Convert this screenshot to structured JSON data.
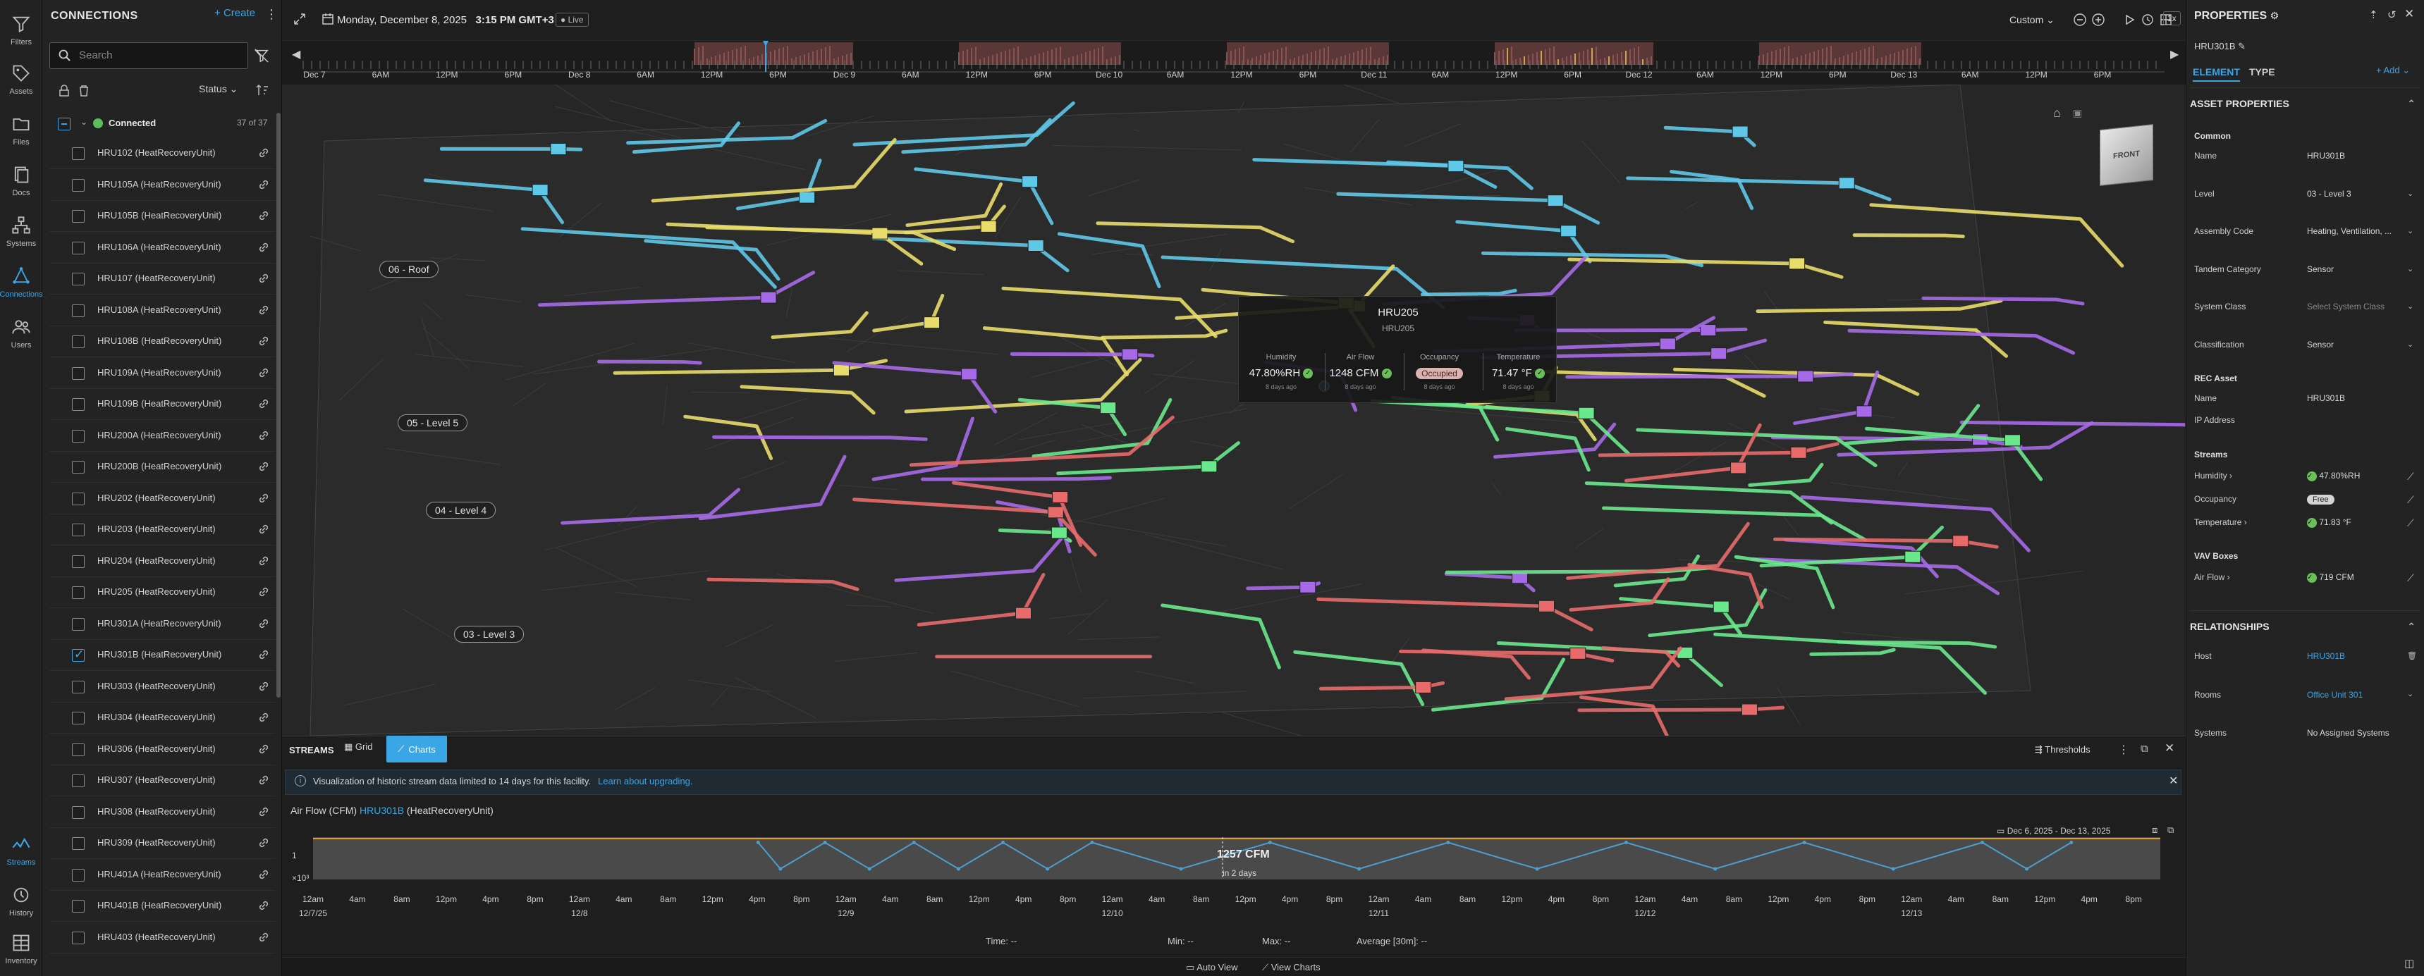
{
  "rail": {
    "items": [
      {
        "label": "Filters",
        "icon": "filter-icon"
      },
      {
        "label": "Assets",
        "icon": "tag-icon"
      },
      {
        "label": "Files",
        "icon": "folder-icon"
      },
      {
        "label": "Docs",
        "icon": "docs-icon"
      },
      {
        "label": "Systems",
        "icon": "systems-icon"
      },
      {
        "label": "Connections",
        "icon": "connections-icon"
      },
      {
        "label": "Users",
        "icon": "users-icon"
      },
      {
        "label": "Streams",
        "icon": "streams-icon"
      },
      {
        "label": "History",
        "icon": "history-icon"
      },
      {
        "label": "Inventory",
        "icon": "inventory-icon"
      }
    ],
    "font_label": "Ab"
  },
  "connections": {
    "title": "CONNECTIONS",
    "create_label": "Create",
    "search_placeholder": "Search",
    "status_label": "Status",
    "group_label": "Connected",
    "group_count": "37 of 37",
    "items": [
      {
        "label": "HRU102 (HeatRecoveryUnit)",
        "checked": false
      },
      {
        "label": "HRU105A (HeatRecoveryUnit)",
        "checked": false
      },
      {
        "label": "HRU105B (HeatRecoveryUnit)",
        "checked": false
      },
      {
        "label": "HRU106A (HeatRecoveryUnit)",
        "checked": false
      },
      {
        "label": "HRU107 (HeatRecoveryUnit)",
        "checked": false
      },
      {
        "label": "HRU108A (HeatRecoveryUnit)",
        "checked": false
      },
      {
        "label": "HRU108B (HeatRecoveryUnit)",
        "checked": false
      },
      {
        "label": "HRU109A (HeatRecoveryUnit)",
        "checked": false
      },
      {
        "label": "HRU109B (HeatRecoveryUnit)",
        "checked": false
      },
      {
        "label": "HRU200A (HeatRecoveryUnit)",
        "checked": false
      },
      {
        "label": "HRU200B (HeatRecoveryUnit)",
        "checked": false
      },
      {
        "label": "HRU202 (HeatRecoveryUnit)",
        "checked": false
      },
      {
        "label": "HRU203 (HeatRecoveryUnit)",
        "checked": false
      },
      {
        "label": "HRU204 (HeatRecoveryUnit)",
        "checked": false
      },
      {
        "label": "HRU205 (HeatRecoveryUnit)",
        "checked": false
      },
      {
        "label": "HRU301A (HeatRecoveryUnit)",
        "checked": false
      },
      {
        "label": "HRU301B (HeatRecoveryUnit)",
        "checked": true
      },
      {
        "label": "HRU303 (HeatRecoveryUnit)",
        "checked": false
      },
      {
        "label": "HRU304 (HeatRecoveryUnit)",
        "checked": false
      },
      {
        "label": "HRU306 (HeatRecoveryUnit)",
        "checked": false
      },
      {
        "label": "HRU307 (HeatRecoveryUnit)",
        "checked": false
      },
      {
        "label": "HRU308 (HeatRecoveryUnit)",
        "checked": false
      },
      {
        "label": "HRU309 (HeatRecoveryUnit)",
        "checked": false
      },
      {
        "label": "HRU401A (HeatRecoveryUnit)",
        "checked": false
      },
      {
        "label": "HRU401B (HeatRecoveryUnit)",
        "checked": false
      },
      {
        "label": "HRU403 (HeatRecoveryUnit)",
        "checked": false
      }
    ]
  },
  "topbar": {
    "date": "Monday, December 8, 2025",
    "time": "3:15 PM GMT+3",
    "live": "Live",
    "range_mode": "Custom",
    "speed": "1x",
    "timeline_labels": [
      "Dec 7",
      "6AM",
      "12PM",
      "6PM",
      "Dec 8",
      "6AM",
      "12PM",
      "6PM",
      "Dec 9",
      "6AM",
      "12PM",
      "6PM",
      "Dec 10",
      "6AM",
      "12PM",
      "6PM",
      "Dec 11",
      "6AM",
      "12PM",
      "6PM",
      "Dec 12",
      "6AM",
      "12PM",
      "6PM",
      "Dec 13",
      "6AM",
      "12PM",
      "6PM"
    ]
  },
  "viewport": {
    "levels": [
      "06 - Roof",
      "05 - Level 5",
      "04 - Level 4",
      "03 - Level 3"
    ],
    "cube_label": "FRONT",
    "tooltip": {
      "title": "HRU205",
      "subtitle": "HRU205",
      "metrics": [
        {
          "label": "Humidity",
          "value": "47.80%RH",
          "age": "8 days ago"
        },
        {
          "label": "Air Flow",
          "value": "1248 CFM",
          "age": "8 days ago"
        },
        {
          "label": "Occupancy",
          "value": "Occupied",
          "age": "8 days ago"
        },
        {
          "label": "Temperature",
          "value": "71.47 °F",
          "age": "8 days ago"
        }
      ]
    }
  },
  "streams": {
    "title": "STREAMS",
    "grid_tab": "Grid",
    "charts_tab": "Charts",
    "thresholds": "Thresholds",
    "banner_text": "Visualization of historic stream data limited to 14 days for this facility.",
    "banner_link": "Learn about upgrading.",
    "chart_title_prefix": "Air Flow (CFM)",
    "chart_title_asset": "HRU301B",
    "chart_title_suffix": "(HeatRecoveryUnit)",
    "date_range": "Dec 6, 2025 - Dec 13, 2025",
    "hover_value": "1257 CFM",
    "hover_sub": "in 2 days",
    "footer": {
      "time": "Time: --",
      "min": "Min: --",
      "max": "Max: --",
      "average": "Average [30m]: --"
    },
    "bottom": {
      "auto_view": "Auto View",
      "view_charts": "View Charts"
    }
  },
  "chart_data": {
    "type": "area",
    "title": "Air Flow (CFM)",
    "y_tick_labels": [
      "1",
      "×10³"
    ],
    "x_tick_labels": [
      "12am\n12/7/25",
      "4am",
      "8am",
      "12pm",
      "4pm",
      "8pm",
      "12am\n12/8",
      "4am",
      "8am",
      "12pm",
      "4pm",
      "8pm",
      "12am\n12/9",
      "4am",
      "8am",
      "12pm",
      "4pm",
      "8pm",
      "12am\n12/10",
      "4am",
      "8am",
      "12pm",
      "4pm",
      "8pm",
      "12am\n12/11",
      "4am",
      "8am",
      "12pm",
      "4pm",
      "8pm",
      "12am\n12/12",
      "4am",
      "8am",
      "12pm",
      "4pm",
      "8pm",
      "12am\n12/13",
      "4am",
      "8am",
      "12pm",
      "4pm",
      "8pm"
    ],
    "x_range": [
      "2025-12-07 00:00",
      "2025-12-13 22:00"
    ],
    "series": [
      {
        "color": "#4d9fd1",
        "x": [
          "12/8 16:00",
          "12/8 18:00",
          "12/8 22:00",
          "12/9 02:00",
          "12/9 06:00",
          "12/9 10:00",
          "12/9 14:00",
          "12/9 18:00",
          "12/9 22:00",
          "12/10 06:00",
          "12/10 14:00",
          "12/10 22:00",
          "12/11 06:00",
          "12/11 14:00",
          "12/11 22:00",
          "12/12 06:00",
          "12/12 14:00",
          "12/12 22:00",
          "12/13 06:00",
          "12/13 10:00",
          "12/13 14:00"
        ],
        "y": [
          1250,
          1000,
          1250,
          1000,
          1250,
          1000,
          1250,
          1000,
          1250,
          1000,
          1250,
          1000,
          1250,
          1000,
          1250,
          1000,
          1250,
          1000,
          1250,
          1000,
          1250
        ]
      }
    ],
    "threshold_color": "#e0a030",
    "grid": true
  },
  "properties": {
    "title": "PROPERTIES",
    "asset": "HRU301B",
    "tab_element": "ELEMENT",
    "tab_type": "TYPE",
    "add_label": "Add",
    "section_asset": "ASSET PROPERTIES",
    "common_label": "Common",
    "common": [
      {
        "key": "Name",
        "value": "HRU301B"
      },
      {
        "key": "Level",
        "value": "03 - Level 3"
      },
      {
        "key": "Assembly Code",
        "value": "Heating, Ventilation, ..."
      },
      {
        "key": "Tandem Category",
        "value": "Sensor"
      },
      {
        "key": "System Class",
        "value": "Select System Class"
      },
      {
        "key": "Classification",
        "value": "Sensor"
      }
    ],
    "rec_label": "REC Asset",
    "rec": [
      {
        "key": "Name",
        "value": "HRU301B"
      },
      {
        "key": "IP Address",
        "value": ""
      }
    ],
    "streams_label": "Streams",
    "streams": [
      {
        "key": "Humidity",
        "value": "47.80%RH"
      },
      {
        "key": "Occupancy",
        "value": "Free"
      },
      {
        "key": "Temperature",
        "value": "71.83 °F"
      }
    ],
    "vav_label": "VAV Boxes",
    "vav": [
      {
        "key": "Air Flow",
        "value": "719 CFM"
      }
    ],
    "section_rel": "RELATIONSHIPS",
    "relationships": [
      {
        "key": "Host",
        "value": "HRU301B"
      },
      {
        "key": "Rooms",
        "value": "Office Unit 301"
      },
      {
        "key": "Systems",
        "value": "No Assigned Systems"
      }
    ]
  }
}
